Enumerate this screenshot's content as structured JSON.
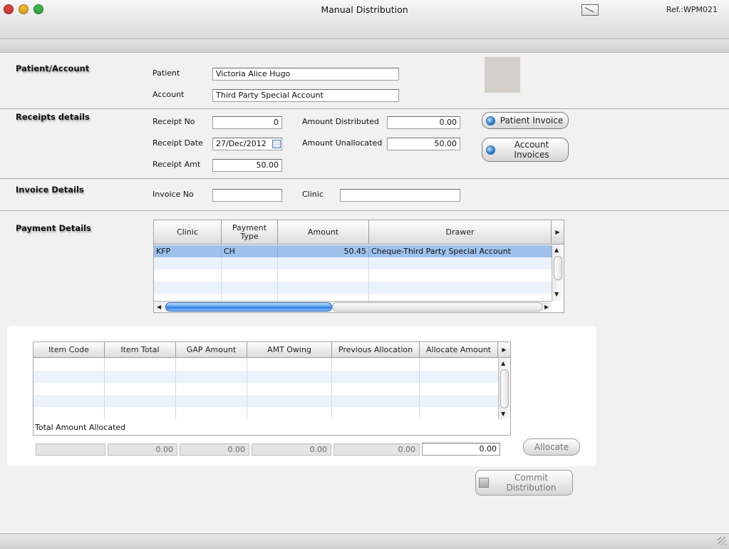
{
  "window": {
    "title": "Manual Distribution",
    "ref": "Ref.:WPM021",
    "colors": {
      "close": "#e0443e",
      "minimize": "#f5b72a",
      "zoom": "#3cb84a"
    }
  },
  "patient_account": {
    "section_title": "Patient/Account",
    "patient_label": "Patient",
    "patient_value": "Victoria Alice Hugo",
    "account_label": "Account",
    "account_value": "Third Party Special Account"
  },
  "receipts": {
    "section_title": "Receipts details",
    "receipt_no_label": "Receipt No",
    "receipt_no_value": "0",
    "receipt_date_label": "Receipt Date",
    "receipt_date_value": "27/Dec/2012",
    "receipt_amt_label": "Receipt Amt",
    "receipt_amt_value": "50.00",
    "amount_distributed_label": "Amount Distributed",
    "amount_distributed_value": "0.00",
    "amount_unallocated_label": "Amount Unallocated",
    "amount_unallocated_value": "50.00",
    "patient_invoice_button": "Patient Invoice",
    "account_invoices_button_line1": "Account",
    "account_invoices_button_line2": "Invoices"
  },
  "invoice": {
    "section_title": "Invoice Details",
    "invoice_no_label": "Invoice No",
    "invoice_no_value": "",
    "clinic_label": "Clinic",
    "clinic_value": ""
  },
  "payment": {
    "section_title": "Payment Details",
    "columns": [
      {
        "line1": "Clinic",
        "line2": ""
      },
      {
        "line1": "Payment",
        "line2": "Type"
      },
      {
        "line1": "Amount",
        "line2": ""
      },
      {
        "line1": "Drawer",
        "line2": ""
      }
    ],
    "rows": [
      {
        "clinic": "KFP",
        "payment_type": "CH",
        "amount": "50.45",
        "drawer": "Cheque-Third Party Special Account",
        "selected": true
      }
    ]
  },
  "allocation": {
    "columns": [
      "Item Code",
      "Item Total",
      "GAP Amount",
      "AMT Owing",
      "Previous Allocation",
      "Allocate Amount"
    ],
    "total_label": "Total Amount Allocated",
    "totals": [
      "",
      "0.00",
      "0.00",
      "0.00",
      "0.00",
      "0.00"
    ],
    "allocate_button": "Allocate"
  },
  "commit": {
    "line1": "Commit",
    "line2": "Distribution"
  }
}
